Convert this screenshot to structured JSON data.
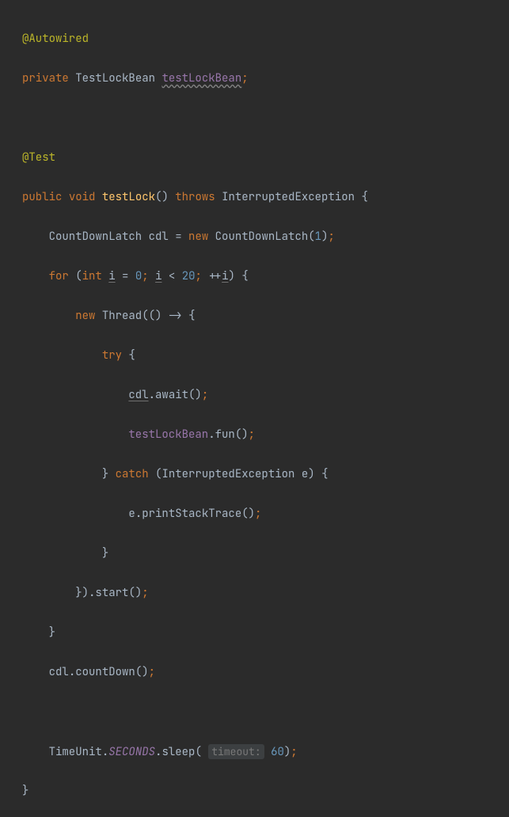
{
  "code": {
    "l1": {
      "anno": "@Autowired"
    },
    "l2": {
      "kw_private": "private",
      "type": "TestLockBean",
      "field": "testLockBean",
      "semi": ";"
    },
    "l4": {
      "anno": "@Test"
    },
    "l5": {
      "kw_public": "public",
      "kw_void": "void",
      "method": "testLock",
      "lp": "(",
      "rp": ")",
      "kw_throws": "throws",
      "exc": "InterruptedException",
      "lbr": "{"
    },
    "l6": {
      "type": "CountDownLatch",
      "var": "cdl",
      "eq": "=",
      "kw_new": "new",
      "ctor": "CountDownLatch",
      "lp": "(",
      "arg": "1",
      "rp": ")",
      "semi": ";"
    },
    "l7": {
      "kw_for": "for",
      "lp": "(",
      "kw_int": "int",
      "var_i": "i",
      "eq": "=",
      "zero": "0",
      "semi1": ";",
      "var_i2": "i",
      "lt": "<",
      "limit": "20",
      "semi2": ";",
      "plusplus": "++",
      "var_i3": "i",
      "rp": ")",
      "lbr": "{"
    },
    "l8": {
      "kw_new": "new",
      "ctor": "Thread",
      "lp": "(",
      "lp2": "(",
      "rp2": ")",
      "arrow": "->",
      "lbr": "{"
    },
    "l9": {
      "kw_try": "try",
      "lbr": "{"
    },
    "l10": {
      "var": "cdl",
      "dot": ".",
      "call": "await",
      "lp": "(",
      "rp": ")",
      "semi": ";"
    },
    "l11": {
      "var": "testLockBean",
      "dot": ".",
      "call": "fun",
      "lp": "(",
      "rp": ")",
      "semi": ";"
    },
    "l12": {
      "rbr": "}",
      "kw_catch": "catch",
      "lp": "(",
      "type": "InterruptedException",
      "param": "e",
      "rp": ")",
      "lbr": "{"
    },
    "l13": {
      "var": "e",
      "dot": ".",
      "call": "printStackTrace",
      "lp": "(",
      "rp": ")",
      "semi": ";"
    },
    "l14": {
      "rbr": "}"
    },
    "l15": {
      "rbr": "}",
      "rp": ")",
      "dot": ".",
      "call": "start",
      "lp": "(",
      "rp2": ")",
      "semi": ";"
    },
    "l16": {
      "rbr": "}"
    },
    "l17": {
      "var": "cdl",
      "dot": ".",
      "call": "countDown",
      "lp": "(",
      "rp": ")",
      "semi": ";"
    },
    "l19": {
      "type": "TimeUnit",
      "dot1": ".",
      "const": "SECONDS",
      "dot2": ".",
      "call": "sleep",
      "lp": "(",
      "hint": "timeout:",
      "arg": "60",
      "rp": ")",
      "semi": ";"
    },
    "l20": {
      "rbr": "}"
    }
  }
}
